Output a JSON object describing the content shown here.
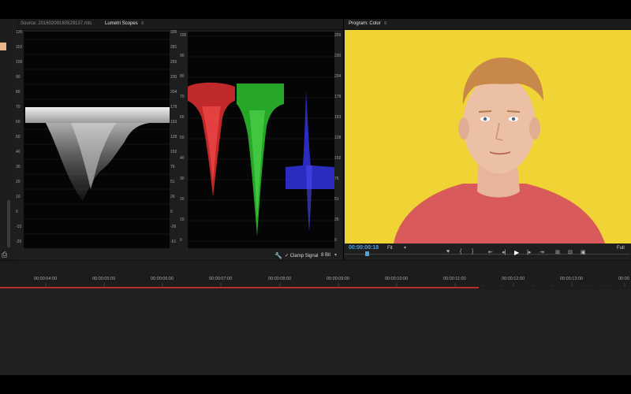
{
  "source_tab": "Source: 20160209160529137.mts",
  "scopes_tab": "Lumetri Scopes",
  "program_tab": "Program: Color",
  "luma_left_axis": [
    "120",
    "110",
    "100",
    "90",
    "80",
    "70",
    "60",
    "50",
    "40",
    "30",
    "20",
    "10",
    "0",
    "-10",
    "-20"
  ],
  "luma_right_axis": [
    "306",
    "281",
    "255",
    "230",
    "204",
    "178",
    "153",
    "128",
    "102",
    "76",
    "51",
    "26",
    "0",
    "-26",
    "-51"
  ],
  "rgb_left_axis": [
    "100",
    "90",
    "80",
    "70",
    "60",
    "50",
    "40",
    "30",
    "20",
    "10",
    "0"
  ],
  "rgb_right_axis": [
    "255",
    "230",
    "204",
    "178",
    "153",
    "128",
    "102",
    "76",
    "51",
    "26",
    "0"
  ],
  "clamp_signal": "✓ Clamp Signal",
  "bit_depth": "8 Bit",
  "timecode": "00:00:00:18",
  "fit_label": "Fit",
  "full_label": "Full",
  "timeline_marks": [
    "00:00:04:00",
    "00:00:05:00",
    "00:00:06:00",
    "00:00:07:00",
    "00:00:08:00",
    "00:00:09:00",
    "00:00:10:00",
    "00:00:11:00",
    "00:00:12:00",
    "00:00:13:00",
    "00:00"
  ],
  "colors": {
    "accent": "#4aa3df",
    "work_area": "#b13030",
    "video_bg": "#f0d334",
    "shirt": "#d95a5a"
  }
}
